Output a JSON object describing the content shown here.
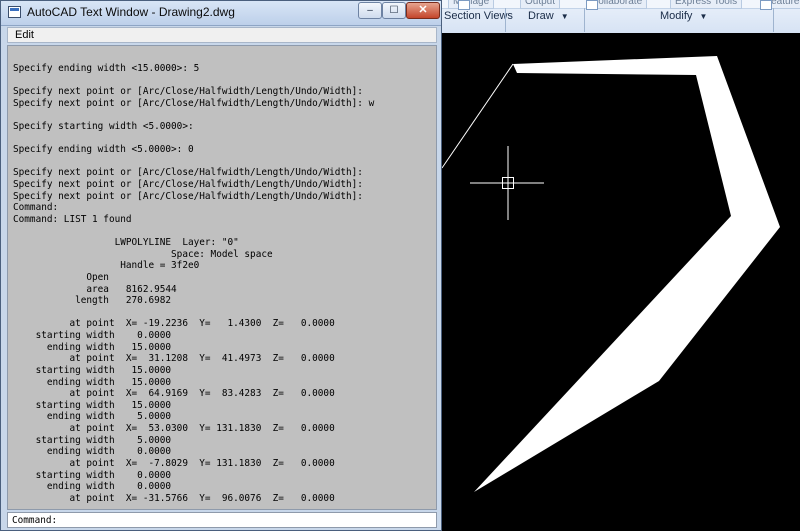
{
  "ribbon": {
    "partial_tabs": [
      "Manage",
      "Output",
      "Collaborate",
      "Express Tools",
      "Featured Apps"
    ],
    "groups": [
      "Section Views",
      "Draw",
      "Modify"
    ]
  },
  "window": {
    "title": "AutoCAD Text Window - Drawing2.dwg",
    "minimize_glyph": "–",
    "maximize_glyph": "☐",
    "close_glyph": "✕"
  },
  "menu": {
    "edit": "Edit"
  },
  "console": {
    "lines": [
      "",
      "Specify ending width <15.0000>: 5",
      "",
      "Specify next point or [Arc/Close/Halfwidth/Length/Undo/Width]:",
      "Specify next point or [Arc/Close/Halfwidth/Length/Undo/Width]: w",
      "",
      "Specify starting width <5.0000>:",
      "",
      "Specify ending width <5.0000>: 0",
      "",
      "Specify next point or [Arc/Close/Halfwidth/Length/Undo/Width]:",
      "Specify next point or [Arc/Close/Halfwidth/Length/Undo/Width]:",
      "Specify next point or [Arc/Close/Halfwidth/Length/Undo/Width]:",
      "Command:",
      "Command: LIST 1 found",
      "",
      "                  LWPOLYLINE  Layer: \"0\"",
      "                            Space: Model space",
      "                   Handle = 3f2e0",
      "             Open",
      "             area   8162.9544",
      "           length   270.6982",
      "",
      "          at point  X= -19.2236  Y=   1.4300  Z=   0.0000",
      "    starting width    0.0000",
      "      ending width   15.0000",
      "          at point  X=  31.1208  Y=  41.4973  Z=   0.0000",
      "    starting width   15.0000",
      "      ending width   15.0000",
      "          at point  X=  64.9169  Y=  83.4283  Z=   0.0000",
      "    starting width   15.0000",
      "      ending width    5.0000",
      "          at point  X=  53.0300  Y= 131.1830  Z=   0.0000",
      "    starting width    5.0000",
      "      ending width    0.0000",
      "          at point  X=  -7.8029  Y= 131.1830  Z=   0.0000",
      "    starting width    0.0000",
      "      ending width    0.0000",
      "          at point  X= -31.5766  Y=  96.0076  Z=   0.0000"
    ]
  },
  "command_line": {
    "prompt": "Command:"
  },
  "colors": {
    "canvas_bg": "#000000",
    "polyline": "#ffffff",
    "crosshair": "#ffffff",
    "console_bg": "#c0c0c0"
  }
}
